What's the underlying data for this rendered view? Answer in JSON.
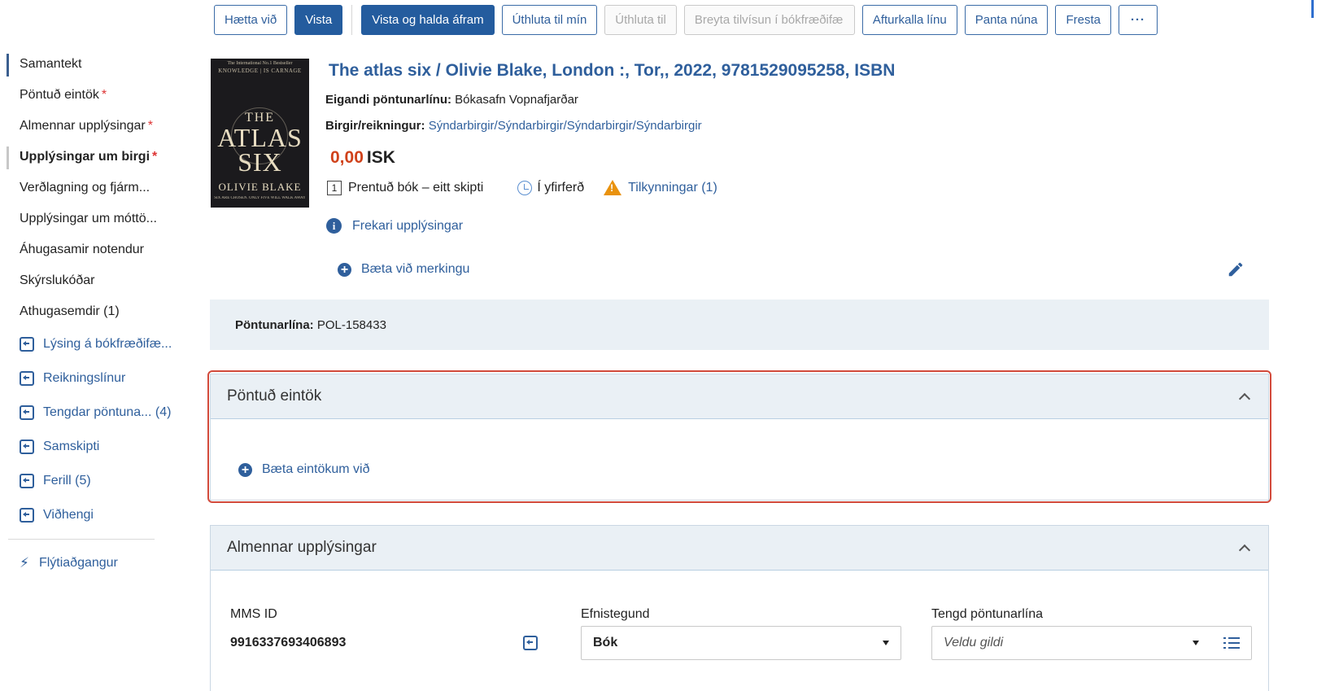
{
  "toolbar": {
    "cancel": "Hætta við",
    "save": "Vista",
    "save_continue": "Vista og halda áfram",
    "assign_me": "Úthluta til mín",
    "assign_to": "Úthluta til",
    "change_ref": "Breyta tilvísun í bókfræðifæ",
    "cancel_line": "Afturkalla línu",
    "order_now": "Panta núna",
    "defer": "Fresta",
    "more": "···"
  },
  "sidebar": {
    "items": [
      {
        "label": "Samantekt",
        "required": ""
      },
      {
        "label": "Pöntuð eintök",
        "required": "*"
      },
      {
        "label": "Almennar upplýsingar",
        "required": "*"
      },
      {
        "label": "Upplýsingar um birgi",
        "required": "*"
      },
      {
        "label": "Verðlagning og fjárm...",
        "required": ""
      },
      {
        "label": "Upplýsingar um móttö...",
        "required": ""
      },
      {
        "label": "Áhugasamir notendur",
        "required": ""
      },
      {
        "label": "Skýrslukóðar",
        "required": ""
      },
      {
        "label": "Athugasemdir (1)",
        "required": ""
      }
    ],
    "links": [
      "Lýsing á bókfræðifæ...",
      "Reikningslínur",
      "Tengdar pöntuna... (4)",
      "Samskipti",
      "Ferill (5)",
      "Viðhengi"
    ],
    "quick_access": "Flýtiaðgangur"
  },
  "cover": {
    "line1": "The International No.1 Bestseller",
    "line2": "KNOWLEDGE  |  IS CARNAGE",
    "the": "THE",
    "word1": "ATLAS",
    "word2": "SIX",
    "author": "OLIVIE BLAKE",
    "tagline": "SIX ARE CHOSEN. ONLY FIVE WILL WALK AWAY"
  },
  "header": {
    "title": "The atlas six / Olivie Blake, London :, Tor,, 2022, 9781529095258, ISBN",
    "owner_label": "Eigandi pöntunarlínu:",
    "owner_value": "Bókasafn Vopnafjarðar",
    "vendor_label": "Birgir/reikningur:",
    "vendor_value": "Sýndarbirgir/Sýndarbirgir/Sýndarbirgir/Sýndarbirgir",
    "price_amount": "0,00",
    "price_currency": "ISK",
    "type_num": "1",
    "type_label": "Prentuð bók – eitt skipti",
    "status": "Í yfirferð",
    "notices": "Tilkynningar (1)",
    "more_info": "Frekari upplýsingar",
    "add_tag": "Bæta við merkingu"
  },
  "pol": {
    "label": "Pöntunarlína:",
    "value": "POL-158433"
  },
  "ordered_section": {
    "title": "Pöntuð eintök",
    "add_copies": "Bæta eintökum við"
  },
  "general_section": {
    "title": "Almennar upplýsingar",
    "mms_label": "MMS ID",
    "mms_value": "9916337693406893",
    "material_label": "Efnistegund",
    "material_value": "Bók",
    "related_label": "Tengd pöntunarlína",
    "related_placeholder": "Veldu gildi"
  },
  "colors": {
    "accent": "#245c9e",
    "link": "#2f5f9c",
    "price": "#d0421b",
    "highlight": "#d24a3b",
    "section_bg": "#eaf0f5"
  }
}
